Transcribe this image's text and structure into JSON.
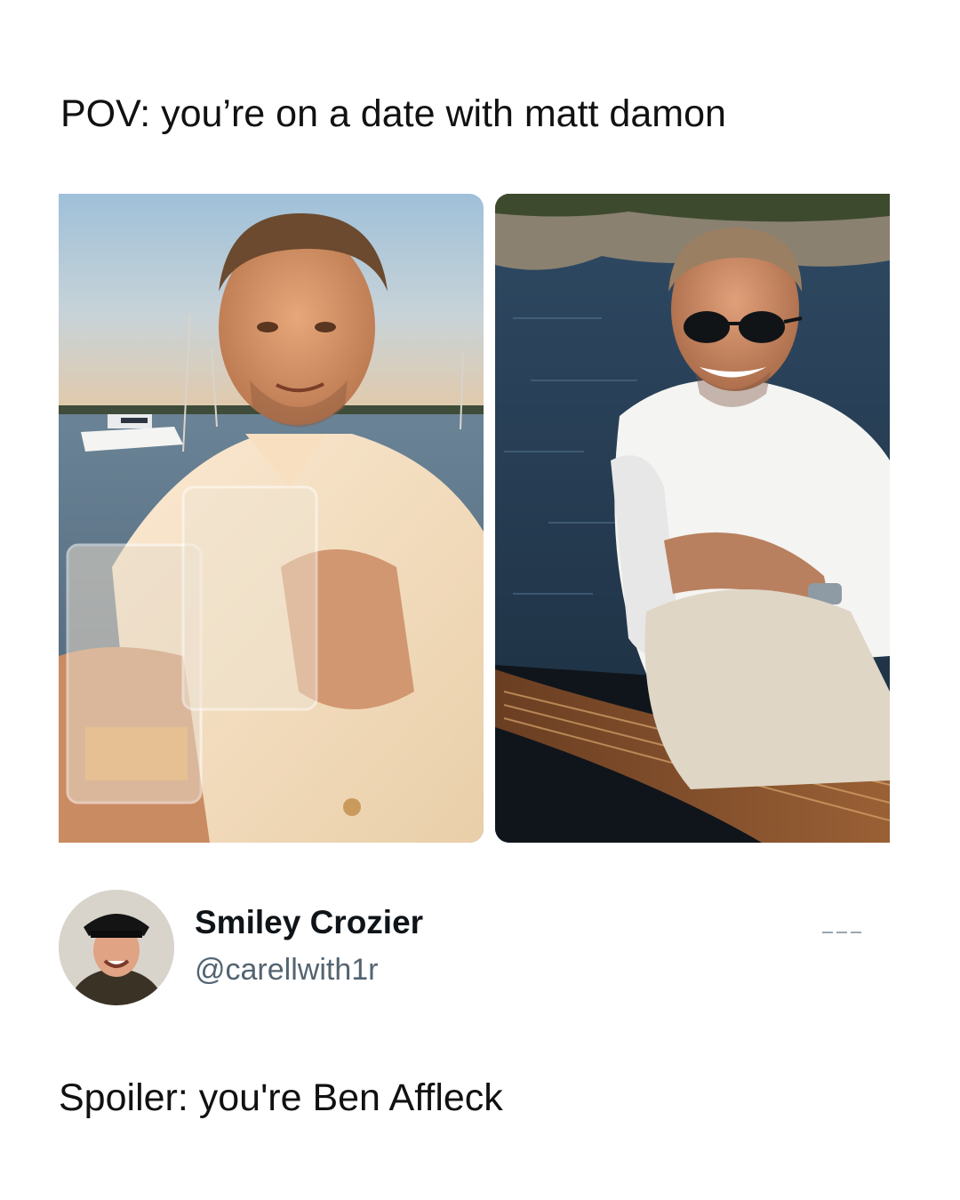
{
  "post": {
    "headline": "POV: you’re on a date with matt damon",
    "images": [
      {
        "icon": "photo-sunset-toast"
      },
      {
        "icon": "photo-boat-sunglasses"
      }
    ]
  },
  "reply": {
    "avatar_icon": "user-avatar-icon",
    "display_name": "Smiley Crozier",
    "handle": "@carellwith1r",
    "text": "Spoiler: you're Ben Affleck",
    "more_icon": "more-options-icon"
  }
}
